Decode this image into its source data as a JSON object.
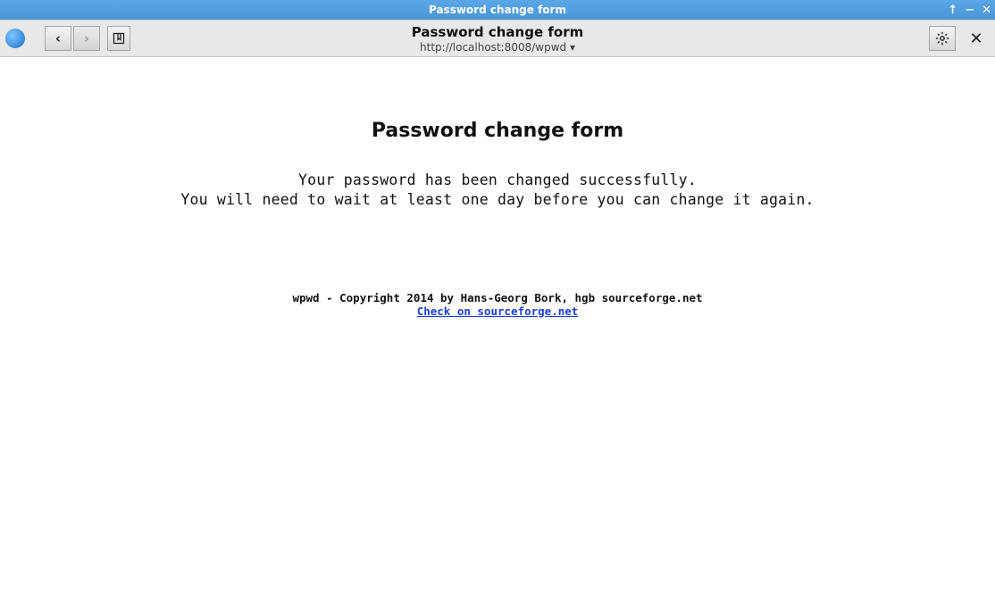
{
  "window": {
    "title": "Password change form"
  },
  "toolbar": {
    "page_title": "Password change form",
    "url_display": "http://localhost:8008/wpwd ▾"
  },
  "content": {
    "heading": "Password change form",
    "line1": "Your password has been changed successfully.",
    "line2": "You will need to wait at least one day before you can change it again."
  },
  "footer": {
    "copyright": "wpwd - Copyright 2014 by Hans-Georg Bork, hgb sourceforge.net",
    "link_text": "Check on sourceforge.net"
  }
}
